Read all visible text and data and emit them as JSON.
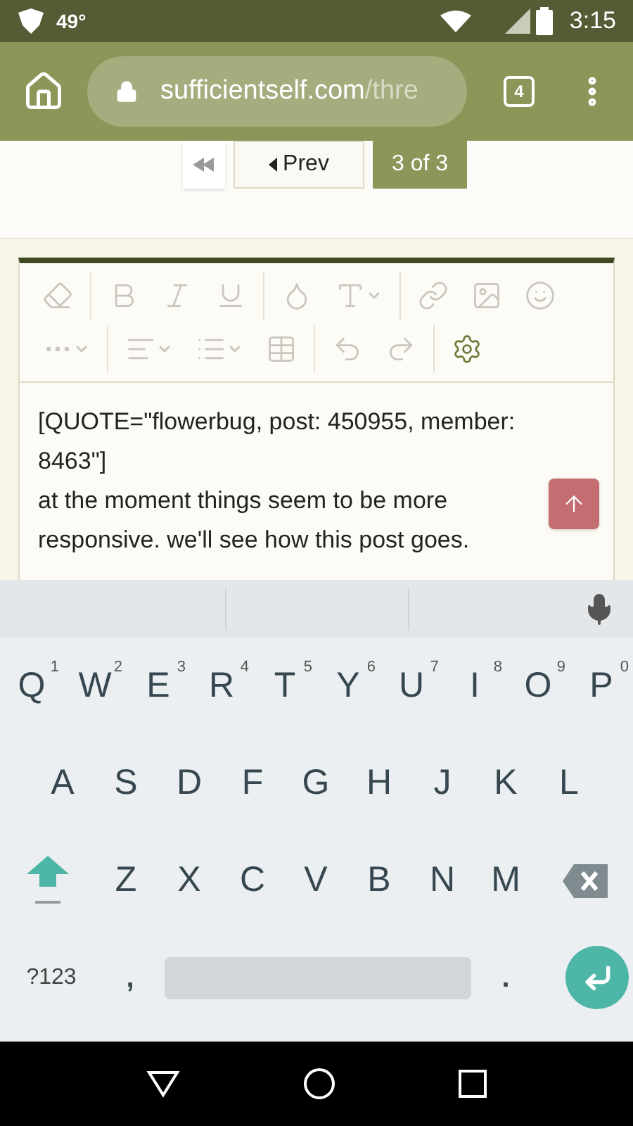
{
  "status_bar": {
    "temperature": "49°",
    "time": "3:15"
  },
  "browser": {
    "url_host": "sufficientself.com",
    "url_path": "/thre",
    "tab_count": "4"
  },
  "pagination": {
    "prev": "Prev",
    "pages": [
      {
        "label": "3 of 3",
        "selected": true
      }
    ]
  },
  "editor": {
    "lines": [
      "[QUOTE=\"flowerbug, post: 450955, member: 8463\"]",
      "at the moment things seem to be more responsive.  we'll see how this post goes."
    ]
  },
  "keyboard": {
    "rows": [
      [
        {
          "label": "Q",
          "hint": "1"
        },
        {
          "label": "W",
          "hint": "2"
        },
        {
          "label": "E",
          "hint": "3"
        },
        {
          "label": "R",
          "hint": "4"
        },
        {
          "label": "T",
          "hint": "5"
        },
        {
          "label": "Y",
          "hint": "6"
        },
        {
          "label": "U",
          "hint": "7"
        },
        {
          "label": "I",
          "hint": "8"
        },
        {
          "label": "O",
          "hint": "9"
        },
        {
          "label": "P",
          "hint": "0"
        }
      ],
      [
        {
          "label": "A"
        },
        {
          "label": "S"
        },
        {
          "label": "D"
        },
        {
          "label": "F"
        },
        {
          "label": "G"
        },
        {
          "label": "H"
        },
        {
          "label": "J"
        },
        {
          "label": "K"
        },
        {
          "label": "L"
        }
      ],
      [
        {
          "kind": "shift"
        },
        {
          "label": "Z"
        },
        {
          "label": "X"
        },
        {
          "label": "C"
        },
        {
          "label": "V"
        },
        {
          "label": "B"
        },
        {
          "label": "N"
        },
        {
          "label": "M"
        },
        {
          "kind": "backspace"
        }
      ]
    ],
    "bottom_row": [
      {
        "kind": "symbols",
        "label": "?123"
      },
      {
        "kind": "key",
        "label": ","
      },
      {
        "kind": "space"
      },
      {
        "kind": "key",
        "label": "."
      },
      {
        "kind": "enter"
      }
    ]
  }
}
